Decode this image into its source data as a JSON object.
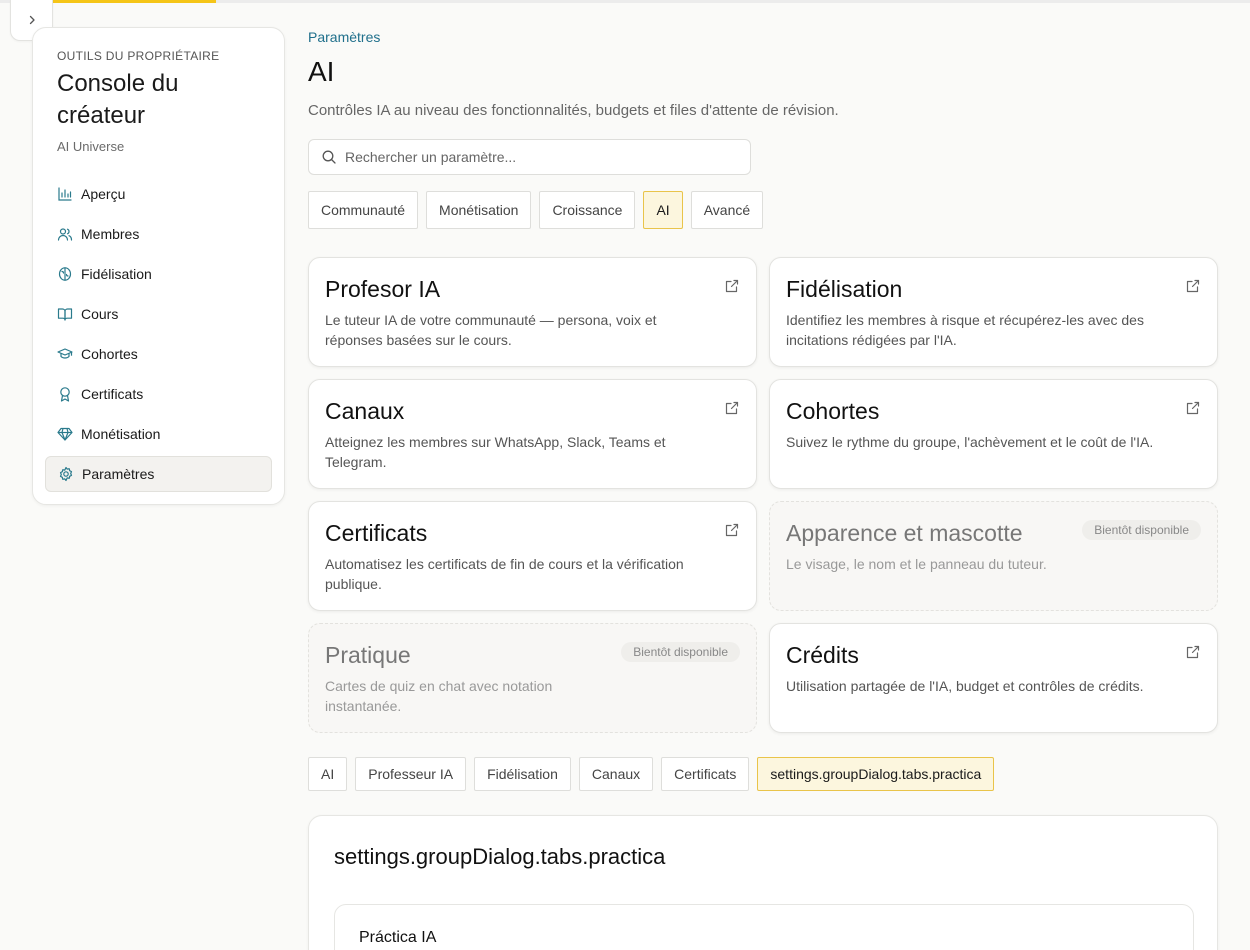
{
  "sidebar": {
    "overline": "OUTILS DU PROPRIÉTAIRE",
    "title": "Console du créateur",
    "subtitle": "AI Universe",
    "items": [
      {
        "label": "Aperçu",
        "icon": "bar-chart-icon"
      },
      {
        "label": "Membres",
        "icon": "users-icon"
      },
      {
        "label": "Fidélisation",
        "icon": "brain-icon"
      },
      {
        "label": "Cours",
        "icon": "book-icon"
      },
      {
        "label": "Cohortes",
        "icon": "graduation-cap-icon"
      },
      {
        "label": "Certificats",
        "icon": "award-icon"
      },
      {
        "label": "Monétisation",
        "icon": "gem-icon"
      },
      {
        "label": "Paramètres",
        "icon": "gear-icon",
        "active": true
      }
    ]
  },
  "header": {
    "breadcrumb": "Paramètres",
    "title": "AI",
    "description": "Contrôles IA au niveau des fonctionnalités, budgets et files d'attente de révision."
  },
  "search": {
    "placeholder": "Rechercher un paramètre..."
  },
  "category_tabs": [
    {
      "label": "Communauté"
    },
    {
      "label": "Monétisation"
    },
    {
      "label": "Croissance"
    },
    {
      "label": "AI",
      "active": true
    },
    {
      "label": "Avancé"
    }
  ],
  "cards": [
    {
      "title": "Profesor IA",
      "description": "Le tuteur IA de votre communauté — persona, voix et réponses basées sur le cours."
    },
    {
      "title": "Fidélisation",
      "description": "Identifiez les membres à risque et récupérez-les avec des incitations rédigées par l'IA."
    },
    {
      "title": "Canaux",
      "description": "Atteignez les membres sur WhatsApp, Slack, Teams et Telegram."
    },
    {
      "title": "Cohortes",
      "description": "Suivez le rythme du groupe, l'achèvement et le coût de l'IA."
    },
    {
      "title": "Certificats",
      "description": "Automatisez les certificats de fin de cours et la vérification publique."
    },
    {
      "title": "Apparence et mascotte",
      "description": "Le visage, le nom et le panneau du tuteur.",
      "badge": "Bientôt disponible"
    },
    {
      "title": "Pratique",
      "description": "Cartes de quiz en chat avec notation instantanée.",
      "badge": "Bientôt disponible"
    },
    {
      "title": "Crédits",
      "description": "Utilisation partagée de l'IA, budget et contrôles de crédits."
    }
  ],
  "group_tabs": [
    {
      "label": "AI"
    },
    {
      "label": "Professeur IA"
    },
    {
      "label": "Fidélisation"
    },
    {
      "label": "Canaux"
    },
    {
      "label": "Certificats"
    },
    {
      "label": "settings.groupDialog.tabs.practica",
      "active": true
    }
  ],
  "panel": {
    "title": "settings.groupDialog.tabs.practica",
    "subpanel_title": "Práctica IA"
  },
  "colors": {
    "accent": "#f5c518",
    "link": "#1f6f8b",
    "active_tab_bg": "#fcf6de",
    "active_tab_border": "#e9c44a",
    "icon_teal": "#2a7a8c"
  }
}
